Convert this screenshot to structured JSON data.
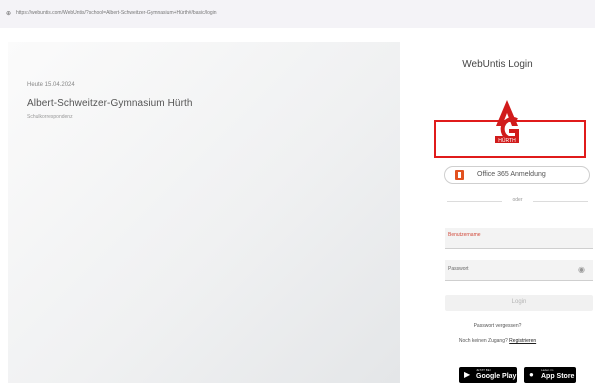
{
  "browser": {
    "url": "https://webuntis.com/WebUntis/?school=Albert-Schweitzer-Gymnasium+Hürth#/basic/login"
  },
  "left_panel": {
    "date": "Heute 15.04.2024",
    "school_name": "Albert-Schweitzer-Gymnasium Hürth",
    "subline": "Schulkorrespondenz"
  },
  "login": {
    "title": "WebUntis Login",
    "office_button": "Office 365 Anmeldung",
    "divider": "oder",
    "username_label": "Benutzername",
    "password_label": "Passwort",
    "login_button": "Login",
    "forgot_password": "Passwort vergessen?",
    "no_account": "Noch keinen Zugang?",
    "register_link": "Registrieren"
  },
  "logo": {
    "text": "HÜRTH",
    "brand_color": "#d11b1b"
  },
  "stores": {
    "google_small": "JETZT BEI",
    "google_big": "Google Play",
    "apple_small": "Laden im",
    "apple_big": "App Store"
  },
  "colors": {
    "accent_red": "#e01b1b",
    "office_orange": "#e2511f"
  }
}
